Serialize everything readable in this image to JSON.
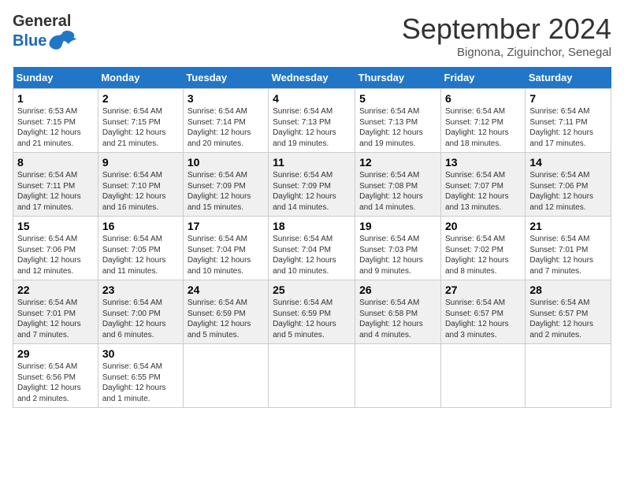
{
  "header": {
    "logo_general": "General",
    "logo_blue": "Blue",
    "month_title": "September 2024",
    "subtitle": "Bignona, Ziguinchor, Senegal"
  },
  "weekdays": [
    "Sunday",
    "Monday",
    "Tuesday",
    "Wednesday",
    "Thursday",
    "Friday",
    "Saturday"
  ],
  "weeks": [
    [
      {
        "day": "1",
        "info": "Sunrise: 6:53 AM\nSunset: 7:15 PM\nDaylight: 12 hours\nand 21 minutes."
      },
      {
        "day": "2",
        "info": "Sunrise: 6:54 AM\nSunset: 7:15 PM\nDaylight: 12 hours\nand 21 minutes."
      },
      {
        "day": "3",
        "info": "Sunrise: 6:54 AM\nSunset: 7:14 PM\nDaylight: 12 hours\nand 20 minutes."
      },
      {
        "day": "4",
        "info": "Sunrise: 6:54 AM\nSunset: 7:13 PM\nDaylight: 12 hours\nand 19 minutes."
      },
      {
        "day": "5",
        "info": "Sunrise: 6:54 AM\nSunset: 7:13 PM\nDaylight: 12 hours\nand 19 minutes."
      },
      {
        "day": "6",
        "info": "Sunrise: 6:54 AM\nSunset: 7:12 PM\nDaylight: 12 hours\nand 18 minutes."
      },
      {
        "day": "7",
        "info": "Sunrise: 6:54 AM\nSunset: 7:11 PM\nDaylight: 12 hours\nand 17 minutes."
      }
    ],
    [
      {
        "day": "8",
        "info": "Sunrise: 6:54 AM\nSunset: 7:11 PM\nDaylight: 12 hours\nand 17 minutes."
      },
      {
        "day": "9",
        "info": "Sunrise: 6:54 AM\nSunset: 7:10 PM\nDaylight: 12 hours\nand 16 minutes."
      },
      {
        "day": "10",
        "info": "Sunrise: 6:54 AM\nSunset: 7:09 PM\nDaylight: 12 hours\nand 15 minutes."
      },
      {
        "day": "11",
        "info": "Sunrise: 6:54 AM\nSunset: 7:09 PM\nDaylight: 12 hours\nand 14 minutes."
      },
      {
        "day": "12",
        "info": "Sunrise: 6:54 AM\nSunset: 7:08 PM\nDaylight: 12 hours\nand 14 minutes."
      },
      {
        "day": "13",
        "info": "Sunrise: 6:54 AM\nSunset: 7:07 PM\nDaylight: 12 hours\nand 13 minutes."
      },
      {
        "day": "14",
        "info": "Sunrise: 6:54 AM\nSunset: 7:06 PM\nDaylight: 12 hours\nand 12 minutes."
      }
    ],
    [
      {
        "day": "15",
        "info": "Sunrise: 6:54 AM\nSunset: 7:06 PM\nDaylight: 12 hours\nand 12 minutes."
      },
      {
        "day": "16",
        "info": "Sunrise: 6:54 AM\nSunset: 7:05 PM\nDaylight: 12 hours\nand 11 minutes."
      },
      {
        "day": "17",
        "info": "Sunrise: 6:54 AM\nSunset: 7:04 PM\nDaylight: 12 hours\nand 10 minutes."
      },
      {
        "day": "18",
        "info": "Sunrise: 6:54 AM\nSunset: 7:04 PM\nDaylight: 12 hours\nand 10 minutes."
      },
      {
        "day": "19",
        "info": "Sunrise: 6:54 AM\nSunset: 7:03 PM\nDaylight: 12 hours\nand 9 minutes."
      },
      {
        "day": "20",
        "info": "Sunrise: 6:54 AM\nSunset: 7:02 PM\nDaylight: 12 hours\nand 8 minutes."
      },
      {
        "day": "21",
        "info": "Sunrise: 6:54 AM\nSunset: 7:01 PM\nDaylight: 12 hours\nand 7 minutes."
      }
    ],
    [
      {
        "day": "22",
        "info": "Sunrise: 6:54 AM\nSunset: 7:01 PM\nDaylight: 12 hours\nand 7 minutes."
      },
      {
        "day": "23",
        "info": "Sunrise: 6:54 AM\nSunset: 7:00 PM\nDaylight: 12 hours\nand 6 minutes."
      },
      {
        "day": "24",
        "info": "Sunrise: 6:54 AM\nSunset: 6:59 PM\nDaylight: 12 hours\nand 5 minutes."
      },
      {
        "day": "25",
        "info": "Sunrise: 6:54 AM\nSunset: 6:59 PM\nDaylight: 12 hours\nand 5 minutes."
      },
      {
        "day": "26",
        "info": "Sunrise: 6:54 AM\nSunset: 6:58 PM\nDaylight: 12 hours\nand 4 minutes."
      },
      {
        "day": "27",
        "info": "Sunrise: 6:54 AM\nSunset: 6:57 PM\nDaylight: 12 hours\nand 3 minutes."
      },
      {
        "day": "28",
        "info": "Sunrise: 6:54 AM\nSunset: 6:57 PM\nDaylight: 12 hours\nand 2 minutes."
      }
    ],
    [
      {
        "day": "29",
        "info": "Sunrise: 6:54 AM\nSunset: 6:56 PM\nDaylight: 12 hours\nand 2 minutes."
      },
      {
        "day": "30",
        "info": "Sunrise: 6:54 AM\nSunset: 6:55 PM\nDaylight: 12 hours\nand 1 minute."
      },
      null,
      null,
      null,
      null,
      null
    ]
  ]
}
